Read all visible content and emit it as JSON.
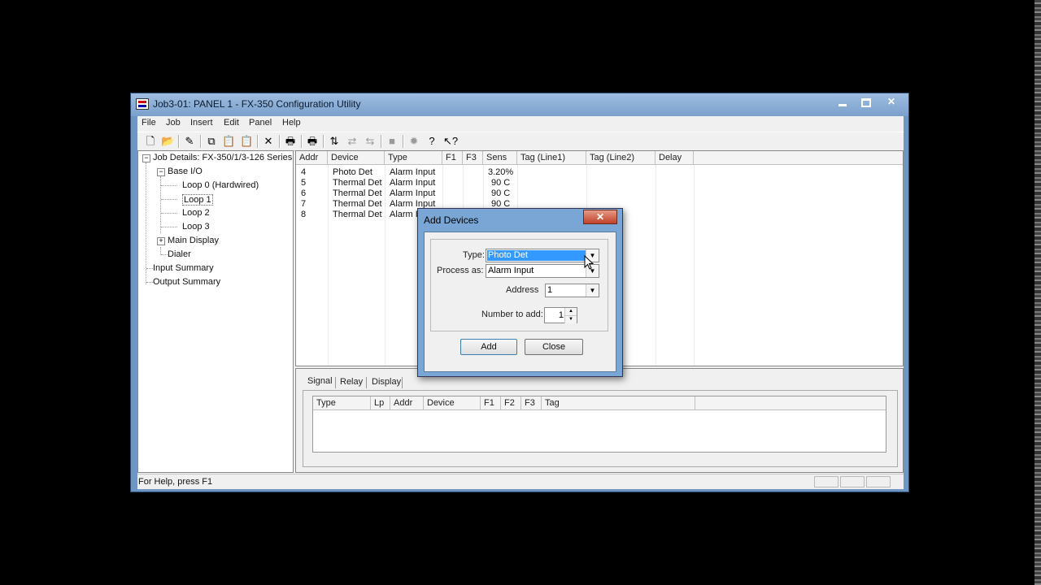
{
  "window": {
    "title": "Job3-01: PANEL 1 - FX-350 Configuration Utility",
    "close_glyph": "✕"
  },
  "menu": [
    "File",
    "Job",
    "Insert",
    "Edit",
    "Panel",
    "Help"
  ],
  "toolbar": {
    "icons": [
      {
        "name": "new-icon",
        "glyph": "🗋"
      },
      {
        "name": "open-icon",
        "glyph": "📂"
      },
      {
        "name": "edit-icon",
        "glyph": "✎"
      },
      {
        "name": "copy-icon",
        "glyph": "⧉"
      },
      {
        "name": "paste-icon",
        "glyph": "📋"
      },
      {
        "name": "paste-special-icon",
        "glyph": "📋"
      },
      {
        "name": "delete-icon",
        "glyph": "✕"
      },
      {
        "name": "print-icon",
        "glyph": "🖶"
      },
      {
        "name": "print-preview-icon",
        "glyph": "🖶"
      },
      {
        "name": "download-icon",
        "glyph": "⇅"
      },
      {
        "name": "upload-icon",
        "glyph": "⇄"
      },
      {
        "name": "transfer-icon",
        "glyph": "⇆"
      },
      {
        "name": "stop-icon",
        "glyph": "■"
      },
      {
        "name": "settings-icon",
        "glyph": "✹"
      },
      {
        "name": "help-icon",
        "glyph": "?"
      },
      {
        "name": "context-help-icon",
        "glyph": "↖?"
      }
    ]
  },
  "tree": {
    "root": "Job Details: FX-350/1/3-126 Series",
    "base_io": "Base I/O",
    "loop0": "Loop 0  (Hardwired)",
    "loop1": "Loop 1",
    "loop2": "Loop 2",
    "loop3": "Loop 3",
    "main_display": "Main Display",
    "dialer": "Dialer",
    "input_summary": "Input Summary",
    "output_summary": "Output Summary"
  },
  "grid": {
    "columns": [
      "Addr",
      "Device",
      "Type",
      "F1",
      "F3",
      "Sens",
      "Tag (Line1)",
      "Tag (Line2)",
      "Delay"
    ],
    "rows": [
      [
        "4",
        "Photo Det",
        "Alarm Input",
        "3.20%"
      ],
      [
        "5",
        "Thermal Det",
        "Alarm Input",
        "90 C"
      ],
      [
        "6",
        "Thermal Det",
        "Alarm Input",
        "90 C"
      ],
      [
        "7",
        "Thermal Det",
        "Alarm Input",
        "90 C"
      ],
      [
        "8",
        "Thermal Det",
        "Alarm In",
        ""
      ]
    ]
  },
  "lower": {
    "tabs": [
      "Signal",
      "Relay",
      "Display"
    ],
    "columns": [
      "Type",
      "Lp",
      "Addr",
      "Device",
      "F1",
      "F2",
      "F3",
      "Tag"
    ]
  },
  "status": {
    "text": "For Help, press F1"
  },
  "dialog": {
    "title": "Add Devices",
    "close_glyph": "✕",
    "type_label": "Type:",
    "type_value": "Photo Det",
    "process_label": "Process as:",
    "process_value": "Alarm Input",
    "address_label": "Address",
    "address_value": "1",
    "number_label": "Number to add:",
    "number_value": "1",
    "add_button": "Add",
    "close_button": "Close",
    "arrow_glyph": "▼",
    "up_glyph": "▲",
    "down_glyph": "▼"
  }
}
